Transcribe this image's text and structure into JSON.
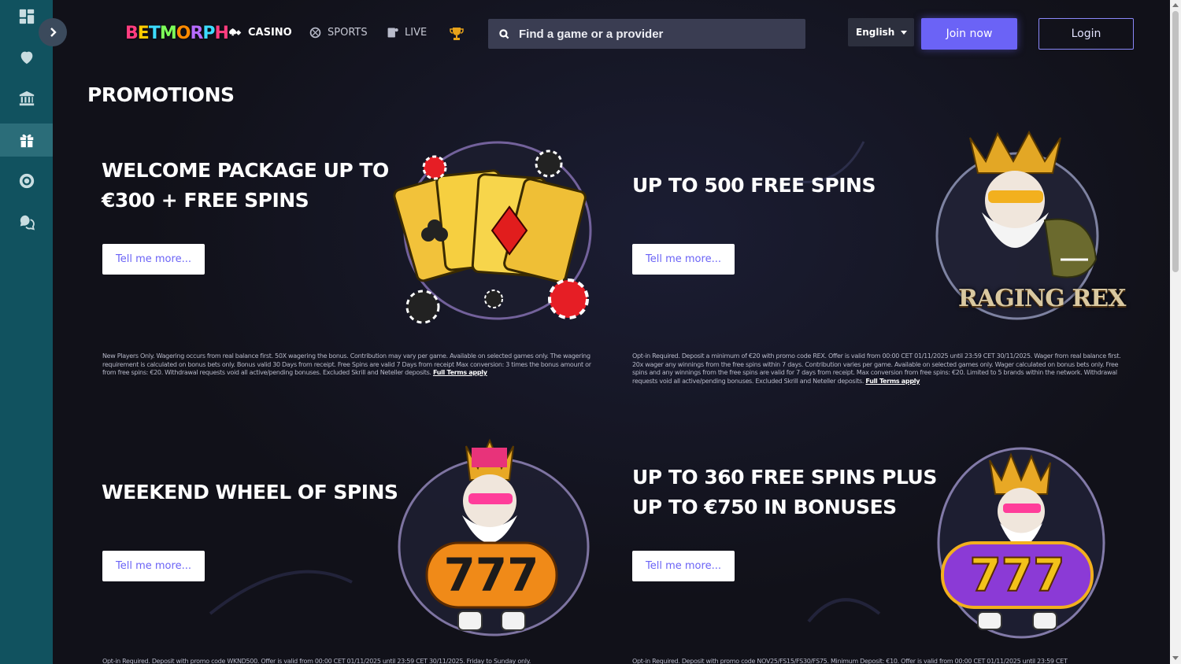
{
  "app": {
    "logo_text": "BETMORPH",
    "logo_colors": [
      "#ff3d7f",
      "#ffcc00",
      "#3ddcff",
      "#7dff5a",
      "#ff8a00",
      "#b66bff",
      "#3ddcff",
      "#ff3d7f"
    ]
  },
  "sidebar": {
    "items": [
      {
        "name": "dashboard-icon"
      },
      {
        "name": "heart-icon"
      },
      {
        "name": "bank-icon"
      },
      {
        "name": "gift-icon",
        "active": true
      },
      {
        "name": "lifebuoy-icon"
      },
      {
        "name": "support-chat-icon"
      }
    ]
  },
  "nav": {
    "casino": "CASINO",
    "sports": "SPORTS",
    "live": "LIVE"
  },
  "search": {
    "placeholder": "Find a game or a provider"
  },
  "language": {
    "selected": "English"
  },
  "auth": {
    "join": "Join now",
    "login": "Login"
  },
  "page": {
    "title": "PROMOTIONS"
  },
  "promos": [
    {
      "title_line1": "WELCOME PACKAGE UP TO",
      "title_line2": "€300 + FREE SPINS",
      "button": "Tell me more...",
      "terms": "New Players Only. Wagering occurs from real balance first. 50X wagering the bonus. Contribution may vary per game. Available on selected games only. The wagering requirement is calculated on bonus bets only. Bonus valid 30 Days from receipt. Free Spins are valid 7 Days from receipt Max conversion: 3 times the bonus amount or from free spins: €20. Withdrawal requests void all active/pending bonuses. Excluded Skrill and Neteller deposits.",
      "terms_link": "Full Terms apply"
    },
    {
      "title_line1": "UP TO 500 FREE SPINS",
      "title_line2": "",
      "button": "Tell me more...",
      "terms": "Opt-in Required. Deposit a minimum of €20 with promo code REX. Offer is valid from 00:00 CET 01/11/2025 until 23:59 CET 30/11/2025. Wager from real balance first. 20x wager any winnings from the free spins within 7 days. Contribution varies per game. Available on selected games only. Wager calculated on bonus bets only. Free spins and any winnings from the free spins are valid for 7 days from receipt. Max conversion from free spins: €20. Limited to 5 brands within the network. Withdrawal requests void all active/pending bonuses. Excluded Skrill and Neteller deposits.",
      "terms_link": "Full Terms apply",
      "art_text": "RAGING REX"
    },
    {
      "title_line1": "WEEKEND WHEEL OF SPINS",
      "title_line2": "",
      "button": "Tell me more...",
      "terms": "Opt-in Required. Deposit with promo code WKND500. Offer is valid from 00:00 CET 01/11/2025 until 23:59 CET 30/11/2025. Friday to Sunday only."
    },
    {
      "title_line1": "UP TO 360 FREE SPINS PLUS",
      "title_line2": "UP TO €750 IN BONUSES",
      "button": "Tell me more...",
      "terms": "Opt-in Required. Deposit with promo code NOV25/FS15/FS30/FS75. Minimum Deposit: €10. Offer is valid from 00:00 CET 01/11/2025 until 23:59 CET"
    }
  ],
  "slot_digits": "777",
  "colors": {
    "sidebar": "#11525f",
    "accent": "#6b63f6",
    "background": "#11111b"
  }
}
